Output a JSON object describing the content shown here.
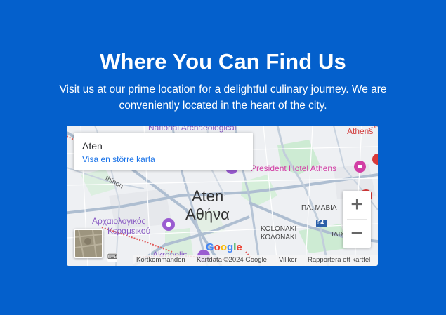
{
  "section": {
    "title": "Where You Can Find Us",
    "subtitle": "Visit us at our prime location for a delightful culinary journey. We are conveniently located in the heart of the city."
  },
  "map": {
    "info_card": {
      "place_name": "Aten",
      "larger_map_link": "Visa en större karta"
    },
    "labels": {
      "national_archaeological": "National Archaeological",
      "athens_top_right": "Athens",
      "president_hotel": "President Hotel Athens",
      "thinon": "thinon",
      "city_latin": "Aten",
      "city_greek": "Αθήνα",
      "archaeological_greek_1": "Αρχαιολογικός",
      "archaeological_greek_2": "Κεραμεικού",
      "pl_mavili": "ΠΛ. ΜΑΒΙΛ",
      "kolonaki_latin": "KOLONAKI",
      "kolonaki_greek": "ΚΟΛΩΝΑΚΙ",
      "iliu": "ΙΛΙΣ",
      "akropolis": "Akropolis",
      "route_number": "54"
    },
    "google_logo": [
      "G",
      "o",
      "o",
      "g",
      "l",
      "e"
    ],
    "google_logo_colors": [
      "#4285F4",
      "#EA4335",
      "#FBBC05",
      "#4285F4",
      "#34A853",
      "#EA4335"
    ],
    "zoom_in_label": "+",
    "zoom_out_label": "−",
    "footer": {
      "keyboard_shortcuts": "Kortkommandon",
      "map_data": "Kartdata ©2024 Google",
      "terms": "Villkor",
      "report": "Rapportera ett kartfel"
    },
    "icons": {
      "keyboard": "keyboard-icon",
      "hotel": "hotel-icon",
      "museum": "museum-icon",
      "landmark": "landmark-icon"
    }
  },
  "colors": {
    "background": "#0460cc",
    "text": "#ffffff",
    "link": "#1a73e8",
    "hotel_pink": "#d23fa5",
    "museum_purple": "#9a5bd1"
  }
}
